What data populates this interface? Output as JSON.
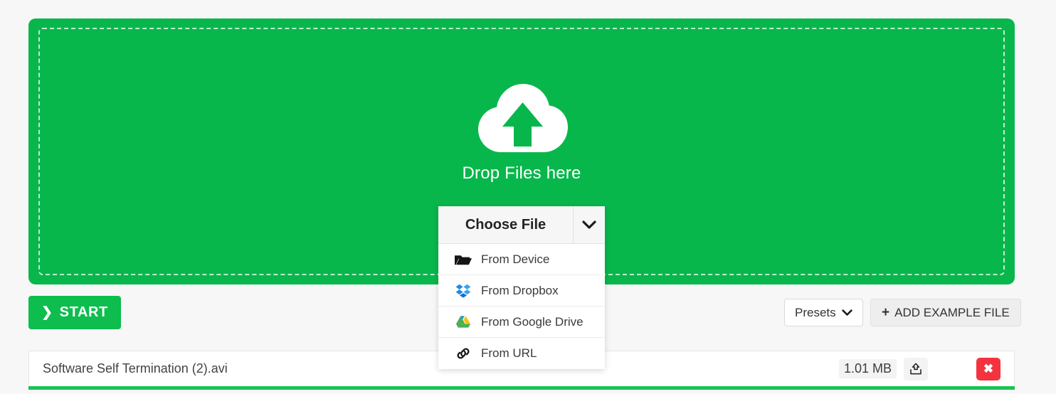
{
  "dropzone": {
    "label": "Drop Files here",
    "icon": "cloud-upload-icon",
    "background_color": "#08b74b"
  },
  "chooser": {
    "button_label": "Choose File",
    "caret_icon": "chevron-down-icon",
    "items": [
      {
        "label": "From Device",
        "icon": "folder-open-icon"
      },
      {
        "label": "From Dropbox",
        "icon": "dropbox-icon"
      },
      {
        "label": "From Google Drive",
        "icon": "google-drive-icon"
      },
      {
        "label": "From URL",
        "icon": "link-icon"
      }
    ]
  },
  "actions": {
    "start_label": "START",
    "start_icon": "chevron-right-icon",
    "start_color": "#0dbd4e",
    "presets_label": "Presets",
    "presets_caret_icon": "chevron-down-icon",
    "add_example_label": "ADD EXAMPLE FILE",
    "add_example_icon": "plus-icon"
  },
  "file_row": {
    "name": "Software Self Termination (2).avi",
    "size": "1.01 MB",
    "export_icon": "upload-tray-icon",
    "remove_label": "✖",
    "remove_color": "#f5333f",
    "progress_percent": 100,
    "progress_color": "#18c452"
  }
}
